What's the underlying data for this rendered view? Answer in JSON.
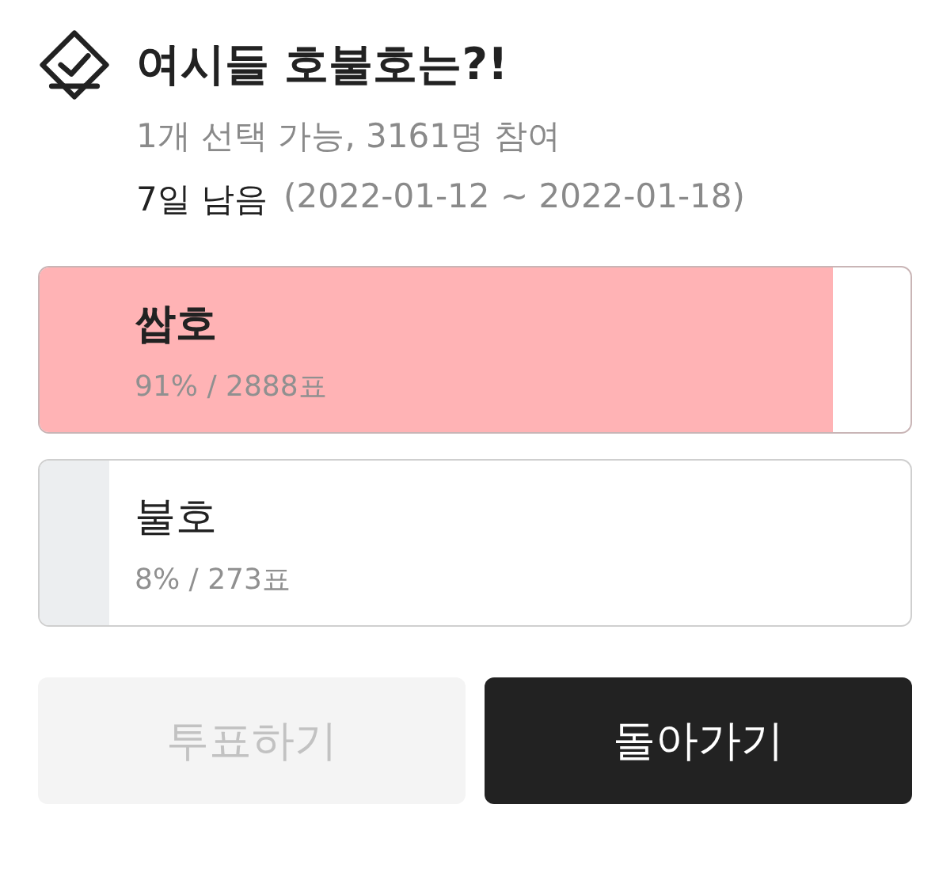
{
  "poll": {
    "title": "여시들 호불호는?!",
    "meta": "1개 선택 가능, 3161명 참여",
    "remaining": "7일 남음",
    "period": "(2022-01-12 ~ 2022-01-18)"
  },
  "options": [
    {
      "label": "쌉호",
      "result": "91% / 2888표",
      "level": 0.91,
      "selected": true
    },
    {
      "label": "불호",
      "result": "8% / 273표",
      "level": 0.08,
      "selected": false
    }
  ],
  "buttons": [
    {
      "label": "투표하기",
      "kind": "secondary",
      "disabled": true
    },
    {
      "label": "돌아가기",
      "kind": "primary",
      "disabled": false
    }
  ]
}
